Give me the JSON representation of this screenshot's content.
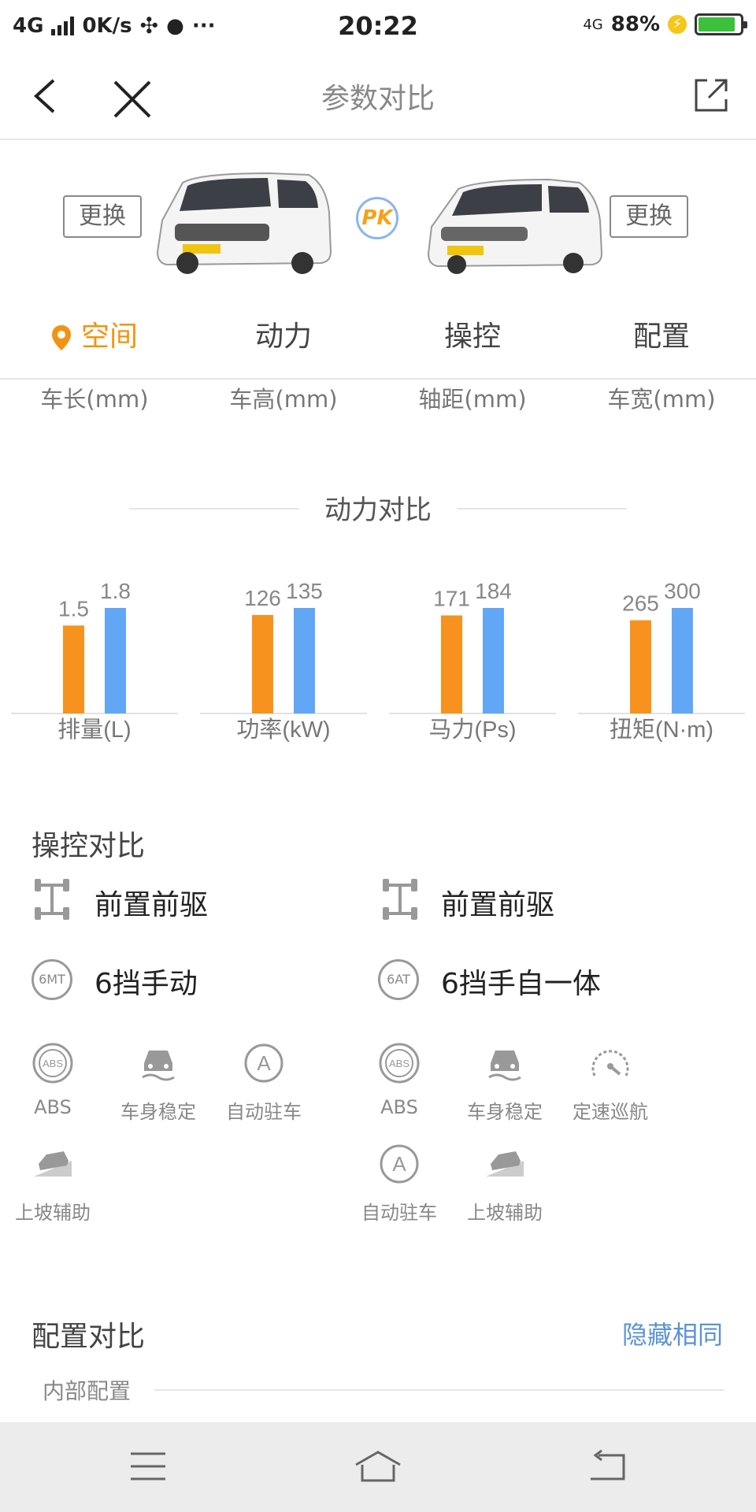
{
  "status_bar": {
    "network": "4G",
    "speed": "0K/s",
    "time": "20:22",
    "right_network": "4G",
    "battery": "88%",
    "battery_level": 0.88
  },
  "nav": {
    "title": "参数对比"
  },
  "compare": {
    "swap_label": "更换",
    "pk_label": "PK"
  },
  "tabs": [
    "空间",
    "动力",
    "操控",
    "配置"
  ],
  "active_tab": 0,
  "space": {
    "labels": [
      "车长(mm)",
      "车高(mm)",
      "轴距(mm)",
      "车宽(mm)"
    ]
  },
  "power": {
    "title": "动力对比"
  },
  "chart_data": {
    "type": "bar",
    "categories": [
      "排量(L)",
      "功率(kW)",
      "马力(Ps)",
      "扭矩(N·m)"
    ],
    "series": [
      {
        "values": [
          1.5,
          126,
          171,
          265
        ],
        "color": "#f7921e"
      },
      {
        "values": [
          1.8,
          135,
          184,
          300
        ],
        "color": "#62a7f5"
      }
    ],
    "data_labels": [
      [
        "1.5",
        "126",
        "171",
        "265"
      ],
      [
        "1.8",
        "135",
        "184",
        "300"
      ]
    ]
  },
  "handling": {
    "title": "操控对比",
    "left": {
      "drive": "前置前驱",
      "gearbox_badge": "6MT",
      "gearbox": "6挡手动"
    },
    "right": {
      "drive": "前置前驱",
      "gearbox_badge": "6AT",
      "gearbox": "6挡手自一体"
    },
    "left_features": [
      "ABS",
      "车身稳定",
      "自动驻车",
      "上坡辅助"
    ],
    "right_features": [
      "ABS",
      "车身稳定",
      "定速巡航",
      "自动驻车",
      "上坡辅助"
    ]
  },
  "config": {
    "title": "配置对比",
    "hide_same": "隐藏相同",
    "section": "内部配置"
  },
  "colors": {
    "accent": "#f29411",
    "left_bar": "#f7921e",
    "right_bar": "#62a7f5",
    "link": "#5b93d6"
  }
}
